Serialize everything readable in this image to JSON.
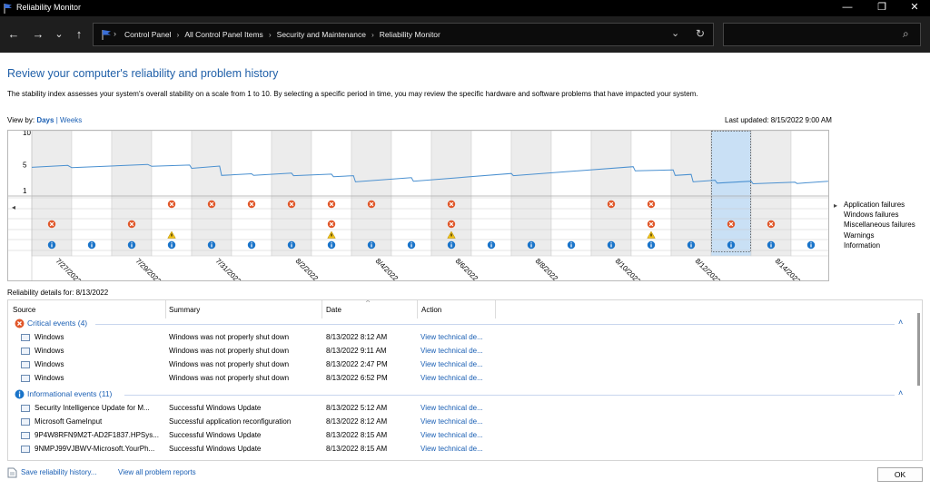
{
  "window": {
    "title": "Reliability Monitor",
    "minimize": "—",
    "maximize": "❐",
    "close": "✕"
  },
  "nav": {
    "back": "←",
    "forward": "→",
    "recent": "⌄",
    "up": "↑",
    "breadcrumbs": [
      "Control Panel",
      "All Control Panel Items",
      "Security and Maintenance",
      "Reliability Monitor"
    ],
    "dropdown": "⌄",
    "refresh": "↻",
    "search_placeholder": "",
    "search_icon": "⌕"
  },
  "header": {
    "title": "Review your computer's reliability and problem history",
    "description": "The stability index assesses your system's overall stability on a scale from 1 to 10. By selecting a specific period in time, you may review the specific hardware and software problems that have impacted your system."
  },
  "view": {
    "label": "View by:",
    "days": "Days",
    "separator": "|",
    "weeks": "Weeks",
    "last_updated": "Last updated: 8/15/2022 9:00 AM"
  },
  "chart_data": {
    "type": "line",
    "ylim": [
      1,
      10
    ],
    "yticks": [
      "10",
      "5",
      "1"
    ],
    "selected_column": 18,
    "date_labels": [
      {
        "col": 1,
        "text": "7/27/2022"
      },
      {
        "col": 3,
        "text": "7/29/2022"
      },
      {
        "col": 5,
        "text": "7/31/2022"
      },
      {
        "col": 7,
        "text": "8/2/2022"
      },
      {
        "col": 9,
        "text": "8/4/2022"
      },
      {
        "col": 11,
        "text": "8/6/2022"
      },
      {
        "col": 13,
        "text": "8/8/2022"
      },
      {
        "col": 15,
        "text": "8/10/2022"
      },
      {
        "col": 17,
        "text": "8/12/2022"
      },
      {
        "col": 19,
        "text": "8/14/2022"
      }
    ],
    "stability_index": [
      [
        0,
        4.6
      ],
      [
        0.9,
        4.9
      ],
      [
        1.0,
        4.55
      ],
      [
        2.9,
        5.05
      ],
      [
        3.0,
        4.75
      ],
      [
        3.95,
        4.95
      ],
      [
        4.0,
        4.45
      ],
      [
        4.7,
        4.8
      ],
      [
        4.75,
        3.35
      ],
      [
        5.5,
        3.6
      ],
      [
        5.55,
        3.35
      ],
      [
        6.5,
        3.7
      ],
      [
        6.55,
        3.3
      ],
      [
        7.5,
        3.55
      ],
      [
        7.55,
        3.15
      ],
      [
        8.05,
        3.3
      ],
      [
        8.1,
        2.35
      ],
      [
        9.5,
        3.0
      ],
      [
        9.55,
        2.45
      ],
      [
        12.0,
        3.65
      ],
      [
        12.05,
        3.3
      ],
      [
        15.05,
        4.7
      ],
      [
        15.1,
        4.05
      ],
      [
        16.05,
        4.2
      ],
      [
        16.1,
        3.35
      ],
      [
        16.5,
        3.5
      ],
      [
        16.55,
        2.35
      ],
      [
        17.1,
        2.6
      ],
      [
        17.15,
        2.15
      ],
      [
        18.0,
        2.45
      ],
      [
        18.05,
        2.05
      ],
      [
        19.1,
        2.3
      ],
      [
        19.15,
        2.1
      ],
      [
        20.6,
        2.75
      ]
    ],
    "series": [
      {
        "name": "Application failures",
        "columns": [
          4,
          5,
          6,
          7,
          8,
          9,
          11,
          15,
          16
        ]
      },
      {
        "name": "Windows failures",
        "columns": []
      },
      {
        "name": "Miscellaneous failures",
        "columns": [
          1,
          3,
          8,
          11,
          16,
          18,
          19
        ]
      },
      {
        "name": "Warnings",
        "columns": [
          4,
          8,
          11,
          16
        ]
      },
      {
        "name": "Information",
        "columns": [
          1,
          2,
          3,
          4,
          5,
          6,
          7,
          8,
          9,
          10,
          11,
          12,
          13,
          14,
          15,
          16,
          17,
          18,
          19,
          20
        ]
      }
    ]
  },
  "details": {
    "label": "Reliability details for: 8/13/2022"
  },
  "table": {
    "columns": [
      "Source",
      "Summary",
      "Date",
      "Action"
    ],
    "groups": [
      {
        "title": "Critical events (4)",
        "kind": "critical",
        "rows": [
          {
            "source": "Windows",
            "summary": "Windows was not properly shut down",
            "date": "8/13/2022 8:12 AM",
            "action": "View technical de..."
          },
          {
            "source": "Windows",
            "summary": "Windows was not properly shut down",
            "date": "8/13/2022 9:11 AM",
            "action": "View technical de..."
          },
          {
            "source": "Windows",
            "summary": "Windows was not properly shut down",
            "date": "8/13/2022 2:47 PM",
            "action": "View technical de..."
          },
          {
            "source": "Windows",
            "summary": "Windows was not properly shut down",
            "date": "8/13/2022 6:52 PM",
            "action": "View technical de..."
          }
        ]
      },
      {
        "title": "Informational events (11)",
        "kind": "info",
        "rows": [
          {
            "source": "Security Intelligence Update for M...",
            "summary": "Successful Windows Update",
            "date": "8/13/2022 5:12 AM",
            "action": "View technical de..."
          },
          {
            "source": "Microsoft GameInput",
            "summary": "Successful application reconfiguration",
            "date": "8/13/2022 8:12 AM",
            "action": "View technical de..."
          },
          {
            "source": "9P4W8RFN9M2T-AD2F1837.HPSys...",
            "summary": "Successful Windows Update",
            "date": "8/13/2022 8:15 AM",
            "action": "View technical de..."
          },
          {
            "source": "9NMPJ99VJBWV-Microsoft.YourPh...",
            "summary": "Successful Windows Update",
            "date": "8/13/2022 8:15 AM",
            "action": "View technical de..."
          }
        ]
      }
    ]
  },
  "footer": {
    "save": "Save reliability history...",
    "all_reports": "View all problem reports",
    "ok": "OK"
  },
  "colors": {
    "accent": "#1a5fb4",
    "error": "#e0572a",
    "warning": "#f2c216",
    "info": "#1a74c9",
    "line": "#4a90d0",
    "selected": "#c9e0f5"
  }
}
